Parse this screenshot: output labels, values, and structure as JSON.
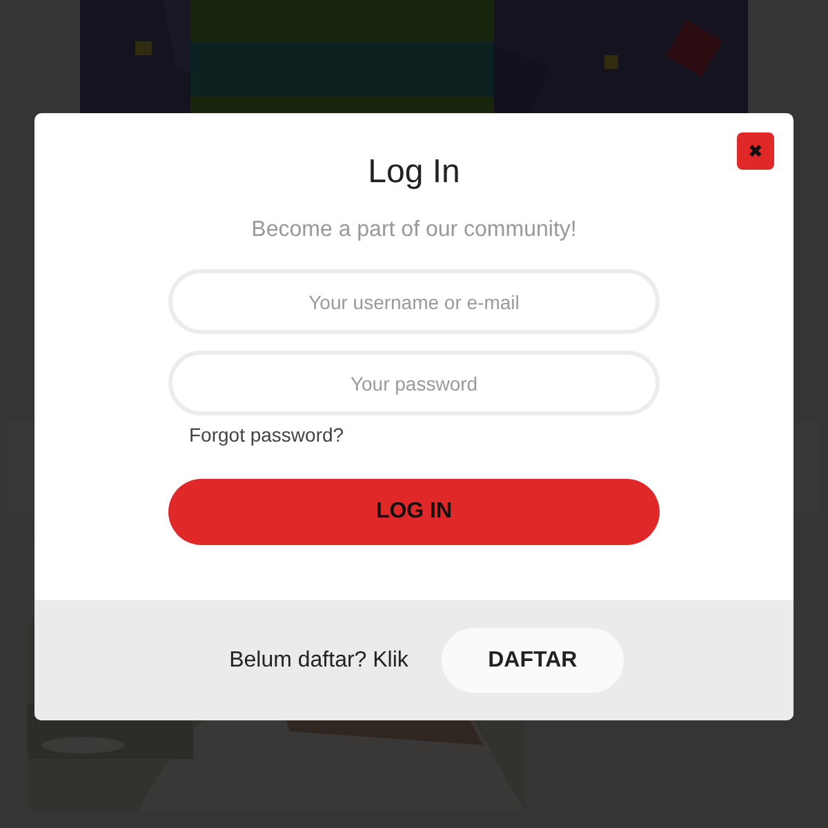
{
  "modal": {
    "close_icon": "✖",
    "title": "Log In",
    "subtitle": "Become a part of our community!",
    "fields": [
      {
        "placeholder": "Your username or e-mail"
      },
      {
        "placeholder": "Your password"
      }
    ],
    "forgot_link": "Forgot password?",
    "submit": "LOG IN",
    "footer": {
      "text": "Belum daftar? Klik",
      "button": "DAFTAR"
    }
  }
}
